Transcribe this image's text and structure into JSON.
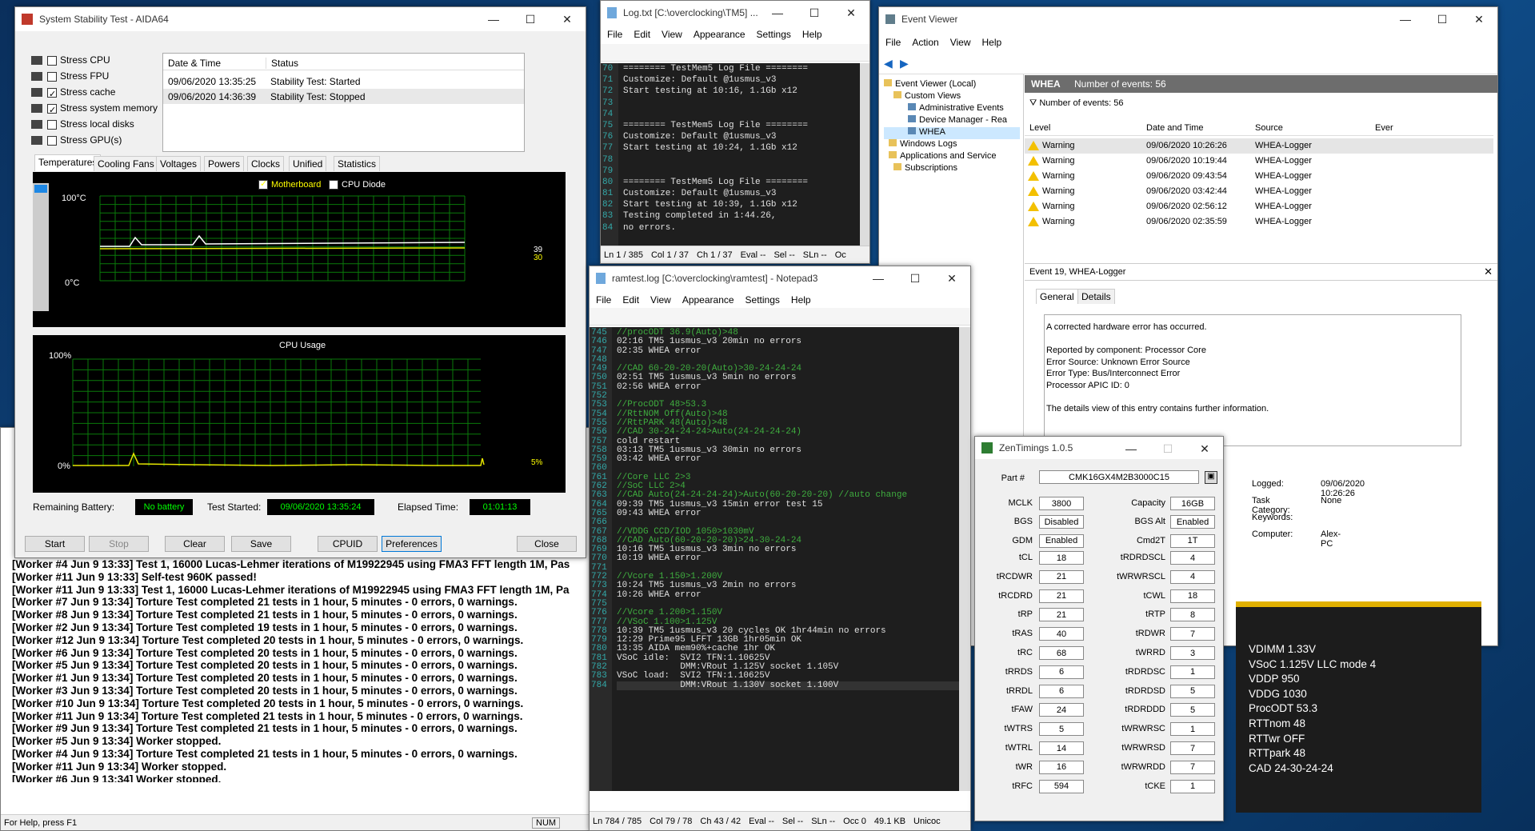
{
  "aida": {
    "title": "System Stability Test - AIDA64",
    "checks": [
      {
        "label": "Stress CPU",
        "on": false
      },
      {
        "label": "Stress FPU",
        "on": false
      },
      {
        "label": "Stress cache",
        "on": true
      },
      {
        "label": "Stress system memory",
        "on": true
      },
      {
        "label": "Stress local disks",
        "on": false
      },
      {
        "label": "Stress GPU(s)",
        "on": false
      }
    ],
    "log_headers": [
      "Date & Time",
      "Status"
    ],
    "log_rows": [
      [
        "09/06/2020 13:35:25",
        "Stability Test: Started"
      ],
      [
        "09/06/2020 14:36:39",
        "Stability Test: Stopped"
      ]
    ],
    "tabs": [
      "Temperatures",
      "Cooling Fans",
      "Voltages",
      "Powers",
      "Clocks",
      "Unified",
      "Statistics"
    ],
    "temp": {
      "legend_mb": "Motherboard",
      "legend_cpu": "CPU Diode",
      "y_top": "100°C",
      "y_bot": "0°C",
      "val1": "39",
      "val2": "30"
    },
    "cpu": {
      "title": "CPU Usage",
      "y_top": "100%",
      "y_bot": "0%",
      "val": "5%"
    },
    "battery_label": "Remaining Battery:",
    "battery": "No battery",
    "started_label": "Test Started:",
    "started": "09/06/2020 13:35:24",
    "elapsed_label": "Elapsed Time:",
    "elapsed": "01:01:13",
    "buttons": [
      "Start",
      "Stop",
      "Clear",
      "Save",
      "CPUID",
      "Preferences",
      "Close"
    ]
  },
  "prime": {
    "lines": [
      "[Worker #4 Jun 9 13:33] Test 1, 16000 Lucas-Lehmer iterations of M19922945 using FMA3 FFT length 1M, Pas",
      "[Worker #11 Jun 9 13:33] Self-test 960K passed!",
      "[Worker #11 Jun 9 13:33] Test 1, 16000 Lucas-Lehmer iterations of M19922945 using FMA3 FFT length 1M, Pa",
      "[Worker #7 Jun 9 13:34] Torture Test completed 21 tests in 1 hour, 5 minutes - 0 errors, 0 warnings.",
      "[Worker #8 Jun 9 13:34] Torture Test completed 21 tests in 1 hour, 5 minutes - 0 errors, 0 warnings.",
      "[Worker #2 Jun 9 13:34] Torture Test completed 19 tests in 1 hour, 5 minutes - 0 errors, 0 warnings.",
      "[Worker #12 Jun 9 13:34] Torture Test completed 20 tests in 1 hour, 5 minutes - 0 errors, 0 warnings.",
      "[Worker #6 Jun 9 13:34] Torture Test completed 20 tests in 1 hour, 5 minutes - 0 errors, 0 warnings.",
      "[Worker #5 Jun 9 13:34] Torture Test completed 20 tests in 1 hour, 5 minutes - 0 errors, 0 warnings.",
      "[Worker #1 Jun 9 13:34] Torture Test completed 20 tests in 1 hour, 5 minutes - 0 errors, 0 warnings.",
      "[Worker #3 Jun 9 13:34] Torture Test completed 20 tests in 1 hour, 5 minutes - 0 errors, 0 warnings.",
      "[Worker #10 Jun 9 13:34] Torture Test completed 20 tests in 1 hour, 5 minutes - 0 errors, 0 warnings.",
      "[Worker #11 Jun 9 13:34] Torture Test completed 21 tests in 1 hour, 5 minutes - 0 errors, 0 warnings.",
      "[Worker #9 Jun 9 13:34] Torture Test completed 21 tests in 1 hour, 5 minutes - 0 errors, 0 warnings.",
      "[Worker #5 Jun 9 13:34] Worker stopped.",
      "[Worker #4 Jun 9 13:34] Torture Test completed 21 tests in 1 hour, 5 minutes - 0 errors, 0 warnings.",
      "[Worker #11 Jun 9 13:34] Worker stopped.",
      "[Worker #6 Jun 9 13:34] Worker stopped."
    ],
    "status": "For Help, press F1",
    "num": "NUM"
  },
  "log": {
    "title": "Log.txt [C:\\overclocking\\TM5] ...",
    "menu": [
      "File",
      "Edit",
      "View",
      "Appearance",
      "Settings",
      "Help"
    ],
    "rows": [
      [
        "70",
        "======== TestMem5 Log File ========"
      ],
      [
        "71",
        "Customize: Default @1usmus_v3"
      ],
      [
        "72",
        "Start testing at 10:16, 1.1Gb x12"
      ],
      [
        "73",
        ""
      ],
      [
        "74",
        ""
      ],
      [
        "75",
        "======== TestMem5 Log File ========"
      ],
      [
        "76",
        "Customize: Default @1usmus_v3"
      ],
      [
        "77",
        "Start testing at 10:24, 1.1Gb x12"
      ],
      [
        "78",
        ""
      ],
      [
        "79",
        ""
      ],
      [
        "80",
        "======== TestMem5 Log File ========"
      ],
      [
        "81",
        "Customize: Default @1usmus_v3"
      ],
      [
        "82",
        "Start testing at 10:39, 1.1Gb x12"
      ],
      [
        "83",
        "Testing completed in 1:44.26,"
      ],
      [
        "84",
        "no errors."
      ]
    ],
    "status": [
      "Ln 1 / 385",
      "Col 1 / 37",
      "Ch 1 / 37",
      "Eval --",
      "Sel --",
      "SLn --",
      "Oc"
    ]
  },
  "ram": {
    "title": "ramtest.log [C:\\overclocking\\ramtest] - Notepad3",
    "menu": [
      "File",
      "Edit",
      "View",
      "Appearance",
      "Settings",
      "Help"
    ],
    "rows": [
      [
        "745",
        "//procODT 36.9(Auto)>48",
        "c"
      ],
      [
        "746",
        "02:16 TM5 1usmus_v3 20min no errors",
        "w"
      ],
      [
        "747",
        "02:35 WHEA error",
        "w"
      ],
      [
        "748",
        "",
        ""
      ],
      [
        "749",
        "//CAD 60-20-20-20(Auto)>30-24-24-24",
        "c"
      ],
      [
        "750",
        "02:51 TM5 1usmus_v3 5min no errors",
        "w"
      ],
      [
        "751",
        "02:56 WHEA error",
        "w"
      ],
      [
        "752",
        "",
        ""
      ],
      [
        "753",
        "//ProcODT 48>53.3",
        "c"
      ],
      [
        "754",
        "//RttNOM Off(Auto)>48",
        "c"
      ],
      [
        "755",
        "//RttPARK 48(Auto)>48",
        "c"
      ],
      [
        "756",
        "//CAD 30-24-24-24>Auto(24-24-24-24)",
        "c"
      ],
      [
        "757",
        "cold restart",
        "w"
      ],
      [
        "758",
        "03:13 TM5 1usmus_v3 30min no errors",
        "w"
      ],
      [
        "759",
        "03:42 WHEA error",
        "w"
      ],
      [
        "760",
        "",
        ""
      ],
      [
        "761",
        "//Core LLC 2>3",
        "c"
      ],
      [
        "762",
        "//SoC LLC 2>4",
        "c"
      ],
      [
        "763",
        "//CAD Auto(24-24-24-24)>Auto(60-20-20-20) //auto change",
        "c"
      ],
      [
        "764",
        "09:39 TM5 1usmus_v3 15min error test 15",
        "w"
      ],
      [
        "765",
        "09:43 WHEA error",
        "w"
      ],
      [
        "766",
        "",
        ""
      ],
      [
        "767",
        "//VDDG CCD/IOD 1050>1030mV",
        "c"
      ],
      [
        "768",
        "//CAD Auto(60-20-20-20)>24-30-24-24",
        "c"
      ],
      [
        "769",
        "10:16 TM5 1usmus_v3 3min no errors",
        "w"
      ],
      [
        "770",
        "10:19 WHEA error",
        "w"
      ],
      [
        "771",
        "",
        ""
      ],
      [
        "772",
        "//Vcore 1.150>1.200V",
        "c"
      ],
      [
        "773",
        "10:24 TM5 1usmus_v3 2min no errors",
        "w"
      ],
      [
        "774",
        "10:26 WHEA error",
        "w"
      ],
      [
        "775",
        "",
        ""
      ],
      [
        "776",
        "//Vcore 1.200>1.150V",
        "c"
      ],
      [
        "777",
        "//VSoC 1.100>1.125V",
        "c"
      ],
      [
        "778",
        "10:39 TM5 1usmus_v3 20 cycles OK 1hr44min no errors",
        "w"
      ],
      [
        "779",
        "12:29 Prime95 LFFT 13GB 1hr05min OK",
        "w"
      ],
      [
        "780",
        "13:35 AIDA mem90%+cache 1hr OK",
        "w"
      ],
      [
        "781",
        "VSoC idle:  SVI2 TFN:1.10625V",
        "w"
      ],
      [
        "782",
        "            DMM:VRout 1.125V socket 1.105V",
        "w"
      ],
      [
        "783",
        "VSoC load:  SVI2 TFN:1.10625V",
        "w"
      ],
      [
        "784",
        "            DMM:VRout 1.130V socket 1.100V",
        "w"
      ]
    ],
    "status": [
      "Ln 784 / 785",
      "Col 79 / 78",
      "Ch 43 / 42",
      "Eval --",
      "Sel --",
      "SLn --",
      "Occ 0",
      "49.1 KB",
      "Unicoc"
    ]
  },
  "ev": {
    "title": "Event Viewer",
    "menu": [
      "File",
      "Action",
      "View",
      "Help"
    ],
    "tree": [
      "Event Viewer (Local)",
      "Custom Views",
      "Administrative Events",
      "Device Manager - Rea",
      "WHEA",
      "Windows Logs",
      "Applications and Service",
      "Subscriptions"
    ],
    "header_name": "WHEA",
    "header_count": "Number of events: 56",
    "filter_count": "Number of events: 56",
    "cols": [
      "Level",
      "Date and Time",
      "Source",
      "Ever"
    ],
    "rows": [
      [
        "Warning",
        "09/06/2020 10:26:26",
        "WHEA-Logger"
      ],
      [
        "Warning",
        "09/06/2020 10:19:44",
        "WHEA-Logger"
      ],
      [
        "Warning",
        "09/06/2020 09:43:54",
        "WHEA-Logger"
      ],
      [
        "Warning",
        "09/06/2020 03:42:44",
        "WHEA-Logger"
      ],
      [
        "Warning",
        "09/06/2020 02:56:12",
        "WHEA-Logger"
      ],
      [
        "Warning",
        "09/06/2020 02:35:59",
        "WHEA-Logger"
      ]
    ],
    "detail_title": "Event 19, WHEA-Logger",
    "tabs": [
      "General",
      "Details"
    ],
    "detail": [
      "A corrected hardware error has occurred.",
      "",
      "Reported by component: Processor Core",
      "Error Source: Unknown Error Source",
      "Error Type: Bus/Interconnect Error",
      "Processor APIC ID: 0",
      "",
      "The details view of this entry contains further information."
    ],
    "props": [
      [
        "Logged:",
        "09/06/2020 10:26:26"
      ],
      [
        "Task Category:",
        "None"
      ],
      [
        "Keywords:",
        ""
      ],
      [
        "Computer:",
        "Alex-PC"
      ]
    ]
  },
  "zt": {
    "title": "ZenTimings 1.0.5",
    "part_label": "Part #",
    "part": "CMK16GX4M2B3000C15",
    "top": [
      [
        "MCLK",
        "3800",
        "Capacity",
        "16GB"
      ],
      [
        "BGS",
        "Disabled",
        "BGS Alt",
        "Enabled"
      ],
      [
        "GDM",
        "Enabled",
        "Cmd2T",
        "1T"
      ]
    ],
    "timings": [
      [
        "tCL",
        "18",
        "tRDRDSCL",
        "4"
      ],
      [
        "tRCDWR",
        "21",
        "tWRWRSCL",
        "4"
      ],
      [
        "tRCDRD",
        "21",
        "tCWL",
        "18"
      ],
      [
        "tRP",
        "21",
        "tRTP",
        "8"
      ],
      [
        "tRAS",
        "40",
        "tRDWR",
        "7"
      ],
      [
        "tRC",
        "68",
        "tWRRD",
        "3"
      ],
      [
        "tRRDS",
        "6",
        "tRDRDSC",
        "1"
      ],
      [
        "tRRDL",
        "6",
        "tRDRDSD",
        "5"
      ],
      [
        "tFAW",
        "24",
        "tRDRDDD",
        "5"
      ],
      [
        "tWTRS",
        "5",
        "tWRWRSC",
        "1"
      ],
      [
        "tWTRL",
        "14",
        "tWRWRSD",
        "7"
      ],
      [
        "tWR",
        "16",
        "tWRWRDD",
        "7"
      ],
      [
        "tRFC",
        "594",
        "tCKE",
        "1"
      ]
    ]
  },
  "note": [
    "VDIMM 1.33V",
    "VSoC 1.125V LLC mode 4",
    "VDDP 950",
    "VDDG 1030",
    "ProcODT 53.3",
    "RTTnom 48",
    "RTTwr OFF",
    "RTTpark 48",
    "CAD 24-30-24-24"
  ]
}
